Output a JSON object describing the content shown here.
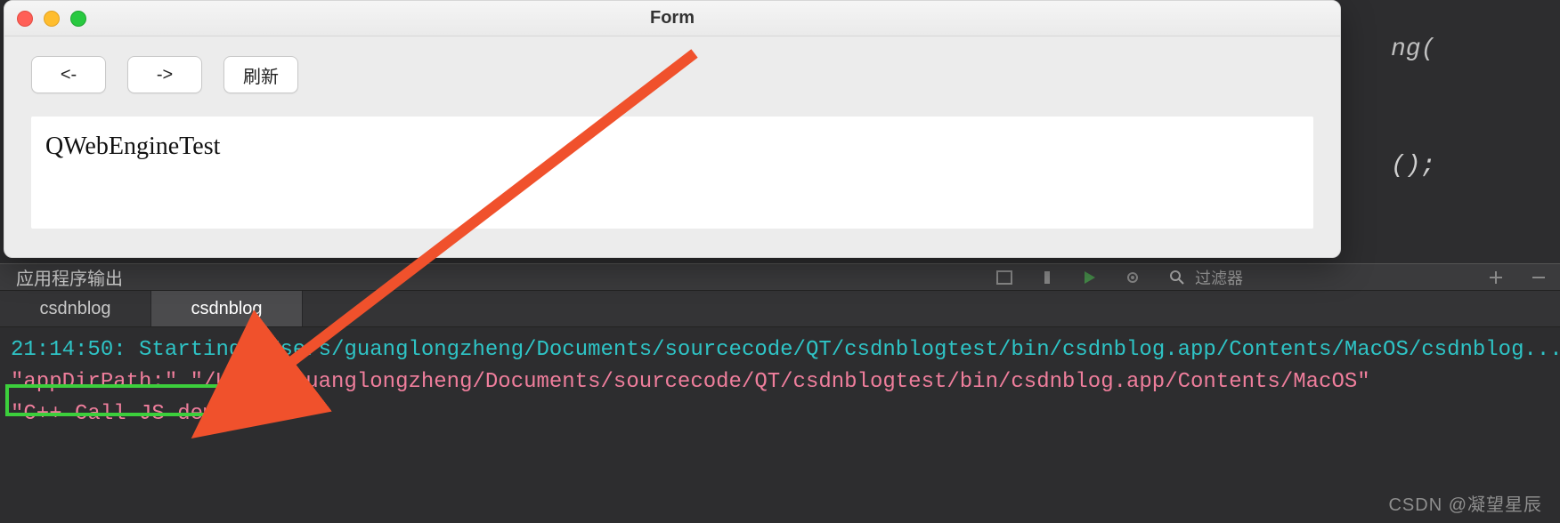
{
  "window": {
    "title": "Form",
    "buttons": {
      "back": "<-",
      "forward": "->",
      "refresh": "刷新"
    },
    "webview_text": "QWebEngineTest"
  },
  "output_header": {
    "label": "应用程序输出",
    "filter_label": "过滤器"
  },
  "tabs": [
    "csdnblog",
    "csdnblog"
  ],
  "console": {
    "line1_time": "21:14:50:",
    "line1_rest": " Starting /Users/guanglongzheng/Documents/sourcecode/QT/csdnblogtest/bin/csdnblog.app/Contents/MacOS/csdnblog...",
    "line2": "\"appDirPath:\" \"/Users/guanglongzheng/Documents/sourcecode/QT/csdnblogtest/bin/csdnblog.app/Contents/MacOS\"",
    "line3": "\"C++ Call JS demo\""
  },
  "bg_code": {
    "l1": "ng(",
    "l2": "();"
  },
  "watermark": "CSDN @凝望星辰",
  "colors": {
    "teal": "#2ec4c6",
    "pink": "#ef7e9c",
    "arrow": "#f0512c",
    "highlight": "#3ccf3c"
  }
}
